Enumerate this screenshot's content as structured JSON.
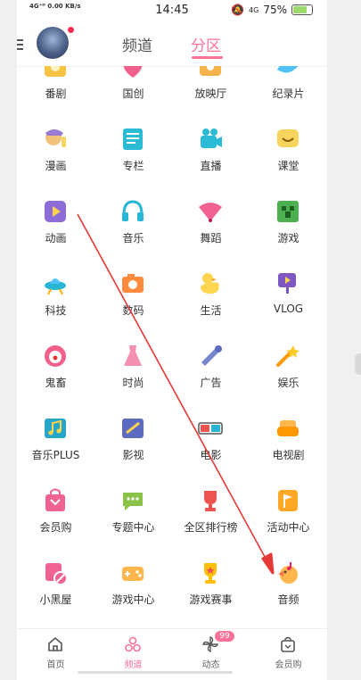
{
  "status_bar": {
    "network": "4G⁺ᴰ 0.00 KB/s",
    "time": "14:45",
    "signal": "4G",
    "battery": "75%"
  },
  "header": {
    "tab_channel": "频道",
    "tab_zone": "分区"
  },
  "grid": [
    {
      "label": "番剧",
      "icon": "bangumi-icon"
    },
    {
      "label": "国创",
      "icon": "guochuang-icon"
    },
    {
      "label": "放映厅",
      "icon": "cinema-hall-icon"
    },
    {
      "label": "纪录片",
      "icon": "whale-icon"
    },
    {
      "label": "漫画",
      "icon": "manga-icon"
    },
    {
      "label": "专栏",
      "icon": "column-icon"
    },
    {
      "label": "直播",
      "icon": "live-camera-icon"
    },
    {
      "label": "课堂",
      "icon": "classroom-icon"
    },
    {
      "label": "动画",
      "icon": "animation-play-icon"
    },
    {
      "label": "音乐",
      "icon": "headphones-icon"
    },
    {
      "label": "舞蹈",
      "icon": "fan-icon"
    },
    {
      "label": "游戏",
      "icon": "creeper-icon"
    },
    {
      "label": "科技",
      "icon": "ufo-icon"
    },
    {
      "label": "数码",
      "icon": "camera-icon"
    },
    {
      "label": "生活",
      "icon": "duck-icon"
    },
    {
      "label": "VLOG",
      "icon": "vlog-icon"
    },
    {
      "label": "鬼畜",
      "icon": "clown-icon"
    },
    {
      "label": "时尚",
      "icon": "dress-icon"
    },
    {
      "label": "广告",
      "icon": "megaphone-icon"
    },
    {
      "label": "娱乐",
      "icon": "magic-wand-icon"
    },
    {
      "label": "音乐PLUS",
      "icon": "music-plus-icon"
    },
    {
      "label": "影视",
      "icon": "film-icon"
    },
    {
      "label": "电影",
      "icon": "3d-glasses-icon"
    },
    {
      "label": "电视剧",
      "icon": "sofa-icon"
    },
    {
      "label": "会员购",
      "icon": "shopping-bag-icon"
    },
    {
      "label": "专题中心",
      "icon": "chat-bubble-icon"
    },
    {
      "label": "全区排行榜",
      "icon": "ranking-trophy-icon"
    },
    {
      "label": "活动中心",
      "icon": "flag-icon"
    },
    {
      "label": "小黑屋",
      "icon": "blacklist-icon"
    },
    {
      "label": "游戏中心",
      "icon": "gamepad-icon"
    },
    {
      "label": "游戏赛事",
      "icon": "trophy-icon"
    },
    {
      "label": "音频",
      "icon": "audio-bird-icon"
    }
  ],
  "tabbar": [
    {
      "label": "首页",
      "icon": "home-icon"
    },
    {
      "label": "频道",
      "icon": "channel-icon"
    },
    {
      "label": "动态",
      "icon": "pinwheel-icon",
      "badge": "99"
    },
    {
      "label": "会员购",
      "icon": "shopping-bag-icon"
    }
  ],
  "colors": {
    "accent": "#fb7299",
    "arrow": "#e53935"
  }
}
